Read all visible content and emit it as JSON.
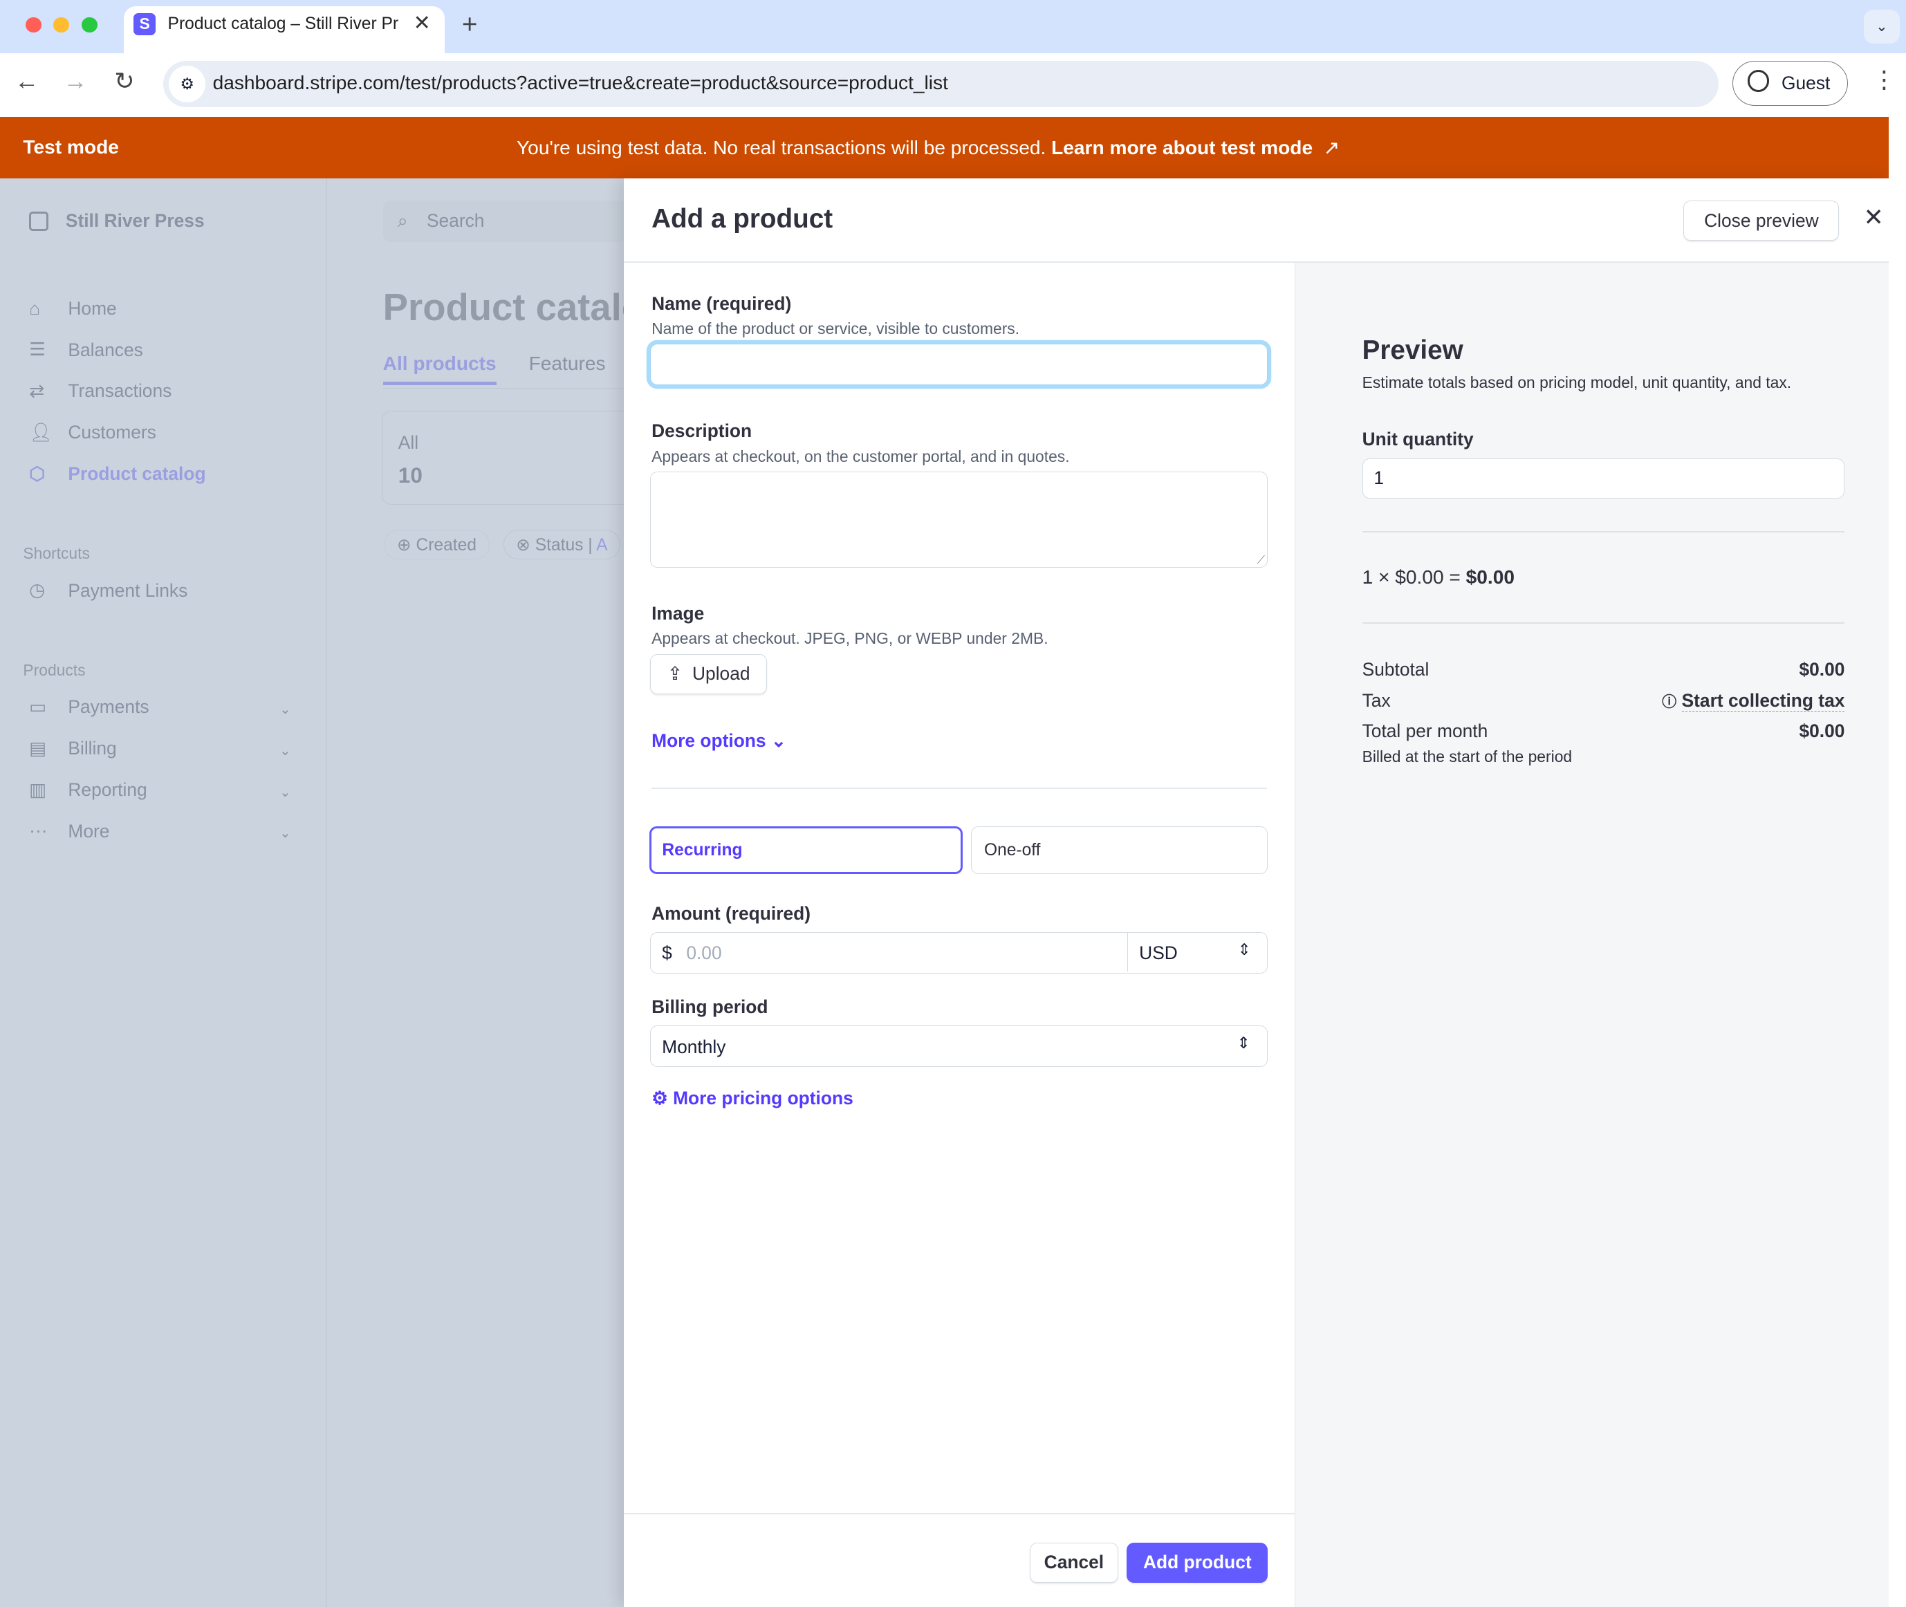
{
  "browser": {
    "tab_title": "Product catalog – Still River Press",
    "favicon_letter": "S",
    "url": "dashboard.stripe.com/test/products?active=true&create=product&source=product_list",
    "profile_label": "Guest"
  },
  "banner": {
    "label": "Test mode",
    "message": "You're using test data. No real transactions will be processed.",
    "link": "Learn more about test mode",
    "color": "#cc4b00"
  },
  "sidebar": {
    "account": "Still River Press",
    "items": [
      {
        "label": "Home",
        "icon": "home-icon"
      },
      {
        "label": "Balances",
        "icon": "balances-icon"
      },
      {
        "label": "Transactions",
        "icon": "transactions-icon"
      },
      {
        "label": "Customers",
        "icon": "customers-icon"
      },
      {
        "label": "Product catalog",
        "icon": "box-icon",
        "active": true
      }
    ],
    "shortcuts_title": "Shortcuts",
    "shortcuts": [
      {
        "label": "Payment Links",
        "icon": "clock-icon"
      }
    ],
    "products_title": "Products",
    "products": [
      {
        "label": "Payments",
        "icon": "wallet-icon"
      },
      {
        "label": "Billing",
        "icon": "billing-icon"
      },
      {
        "label": "Reporting",
        "icon": "chart-icon"
      },
      {
        "label": "More",
        "icon": "more-icon"
      }
    ]
  },
  "background_page": {
    "search_placeholder": "Search",
    "title": "Product catalog",
    "tabs": [
      "All products",
      "Features"
    ],
    "card_label": "All",
    "card_value": "10",
    "filters": [
      "Created",
      "Status"
    ],
    "filter_value_partial": "A"
  },
  "drawer": {
    "title": "Add a product",
    "close_preview": "Close preview",
    "name_label": "Name (required)",
    "name_hint": "Name of the product or service, visible to customers.",
    "name_value": "",
    "description_label": "Description",
    "description_hint": "Appears at checkout, on the customer portal, and in quotes.",
    "image_label": "Image",
    "image_hint": "Appears at checkout. JPEG, PNG, or WEBP under 2MB.",
    "upload": "Upload",
    "more_options": "More options",
    "pricing_types": [
      "Recurring",
      "One-off"
    ],
    "selected_pricing_type": "Recurring",
    "amount_label": "Amount (required)",
    "currency_symbol": "$",
    "amount_placeholder": "0.00",
    "currency": "USD",
    "billing_period_label": "Billing period",
    "billing_period": "Monthly",
    "more_pricing": "More pricing options",
    "cancel": "Cancel",
    "add_product": "Add product",
    "accent": "#635bff"
  },
  "preview": {
    "title": "Preview",
    "subtitle": "Estimate totals based on pricing model, unit quantity, and tax.",
    "unit_quantity_label": "Unit quantity",
    "unit_quantity": "1",
    "calc_prefix": "1 × $0.00 = ",
    "calc_total": "$0.00",
    "subtotal_label": "Subtotal",
    "subtotal": "$0.00",
    "tax_label": "Tax",
    "tax_link": "Start collecting tax",
    "total_label": "Total per month",
    "total": "$0.00",
    "billed_note": "Billed at the start of the period"
  }
}
